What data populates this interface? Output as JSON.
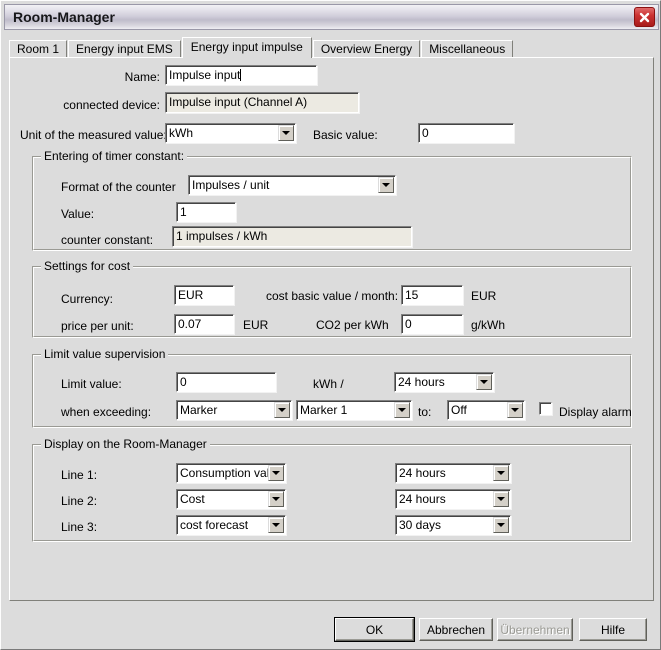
{
  "window": {
    "title": "Room-Manager",
    "close_icon": "close-icon"
  },
  "tabs": [
    {
      "label": "Room 1",
      "active": false
    },
    {
      "label": "Energy input EMS",
      "active": false
    },
    {
      "label": "Energy input impulse",
      "active": true
    },
    {
      "label": "Overview Energy",
      "active": false
    },
    {
      "label": "Miscellaneous",
      "active": false
    }
  ],
  "form": {
    "name_label": "Name:",
    "name_value": "Impulse input",
    "connected_device_label": "connected device:",
    "connected_device_value": "Impulse input  (Channel A)",
    "unit_label": "Unit of the measured value:",
    "unit_value": "kWh",
    "basic_value_label": "Basic value:",
    "basic_value": "0"
  },
  "timer_constant": {
    "group_title": "Entering of timer constant:",
    "format_label": "Format of the counter",
    "format_value": "Impulses / unit",
    "value_label": "Value:",
    "value": "1",
    "counter_constant_label": "counter constant:",
    "counter_constant_value": "1 impulses / kWh"
  },
  "cost": {
    "group_title": "Settings for cost",
    "currency_label": "Currency:",
    "currency_value": "EUR",
    "cost_basic_label": "cost basic value / month:",
    "cost_basic_value": "15",
    "cost_basic_unit": "EUR",
    "price_per_unit_label": "price per unit:",
    "price_per_unit_value": "0.07",
    "price_per_unit_unit": "EUR",
    "co2_label": "CO2 per kWh",
    "co2_value": "0",
    "co2_unit": "g/kWh"
  },
  "limit": {
    "group_title": "Limit value supervision",
    "limit_value_label": "Limit value:",
    "limit_value": "0",
    "unit_text": "kWh /",
    "period_value": "24 hours",
    "exceed_label": "when exceeding:",
    "exceed_target_type": "Marker",
    "exceed_target": "Marker 1",
    "to_label": "to:",
    "to_value": "Off",
    "display_alarm_label": "Display alarm",
    "display_alarm_checked": false
  },
  "display": {
    "group_title": "Display on the Room-Manager",
    "rows": [
      {
        "label": "Line 1:",
        "content": "Consumption value",
        "period": "24 hours"
      },
      {
        "label": "Line 2:",
        "content": "Cost",
        "period": "24 hours"
      },
      {
        "label": "Line 3:",
        "content": "cost forecast",
        "period": "30 days"
      }
    ]
  },
  "buttons": {
    "ok": "OK",
    "cancel": "Abbrechen",
    "apply": "Übernehmen",
    "help": "Hilfe"
  }
}
